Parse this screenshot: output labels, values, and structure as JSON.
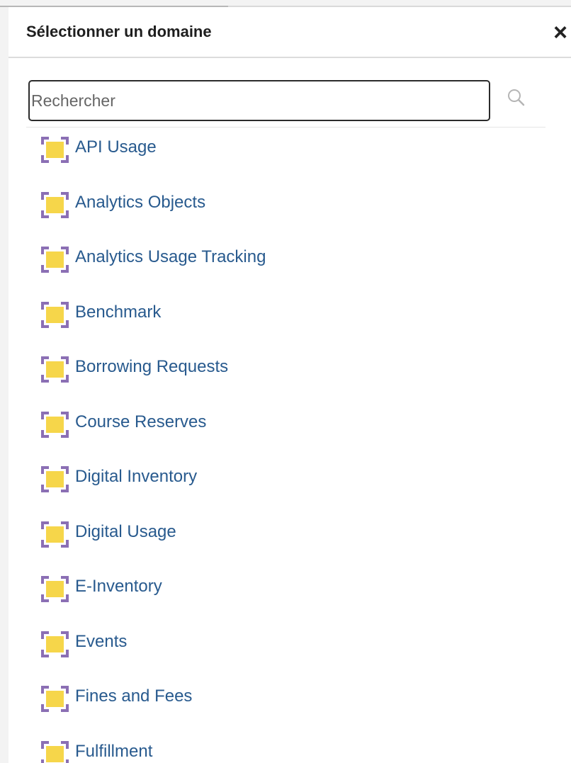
{
  "dialog": {
    "title": "Sélectionner un domaine",
    "close_label": "×"
  },
  "search": {
    "placeholder": "Rechercher",
    "value": ""
  },
  "icons": {
    "close": "close-icon",
    "search": "search-icon",
    "subject_area": "subject-area-icon"
  },
  "colors": {
    "item_text": "#285a8e",
    "icon_purple": "#8b6fb4",
    "icon_yellow": "#f6d64a"
  },
  "subject_areas": [
    {
      "label": "API Usage"
    },
    {
      "label": "Analytics Objects"
    },
    {
      "label": "Analytics Usage Tracking"
    },
    {
      "label": "Benchmark"
    },
    {
      "label": "Borrowing Requests"
    },
    {
      "label": "Course Reserves"
    },
    {
      "label": "Digital Inventory"
    },
    {
      "label": "Digital Usage"
    },
    {
      "label": "E-Inventory"
    },
    {
      "label": "Events"
    },
    {
      "label": "Fines and Fees"
    },
    {
      "label": "Fulfillment"
    }
  ]
}
